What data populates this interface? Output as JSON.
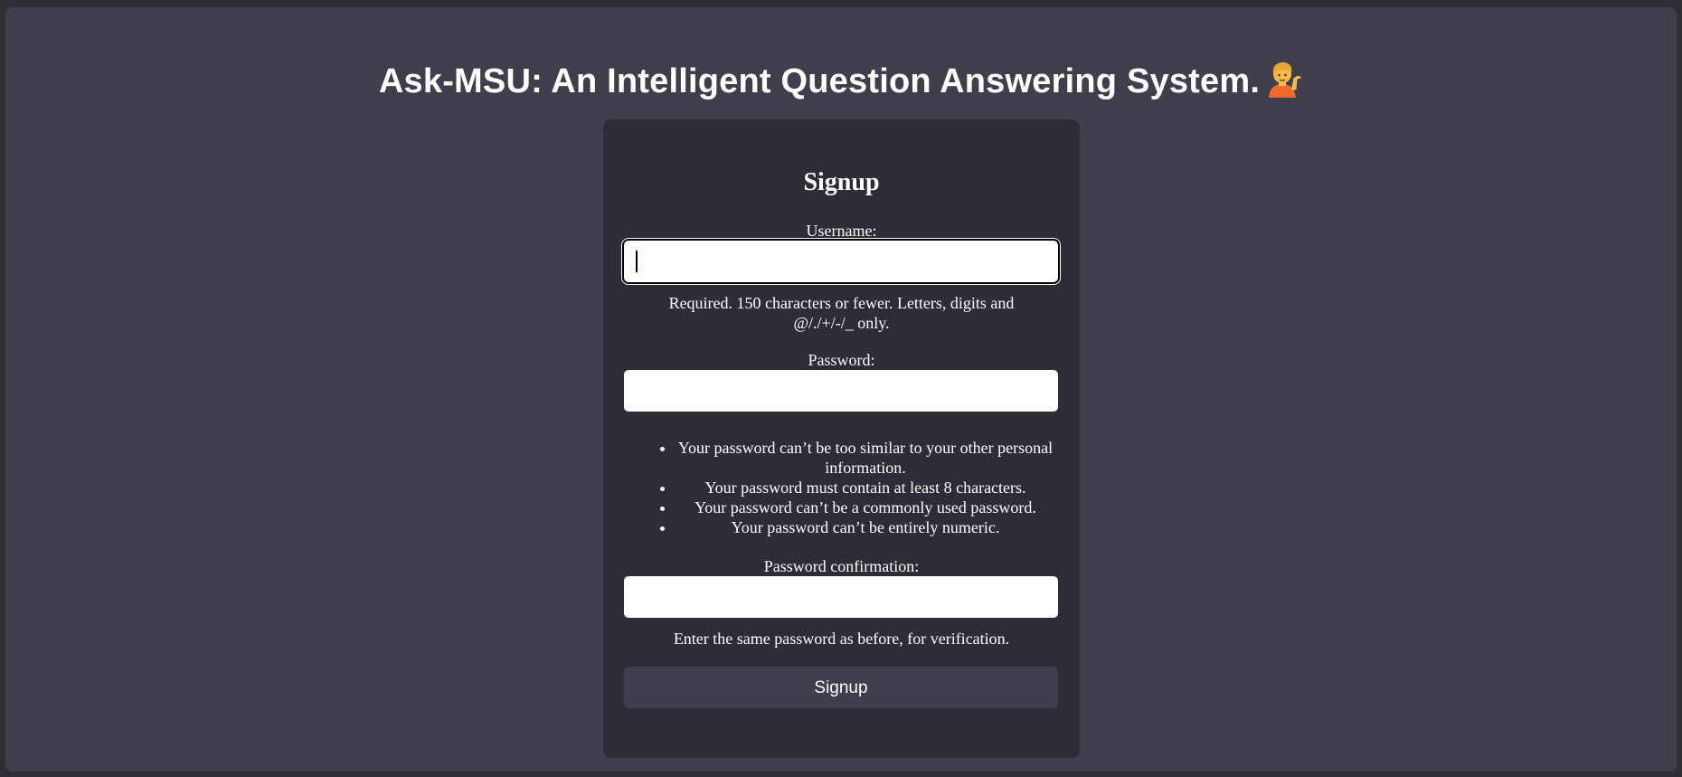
{
  "header": {
    "title": "Ask-MSU: An Intelligent Question Answering System.",
    "emoji_icon": "person-tipping-hand-icon"
  },
  "form": {
    "title": "Signup",
    "username": {
      "label": "Username:",
      "value": "",
      "help": "Required. 150 characters or fewer. Letters, digits and @/./+/-/_ only."
    },
    "password": {
      "label": "Password:",
      "value": "",
      "rules": [
        "Your password can’t be too similar to your other personal information.",
        "Your password must contain at least 8 characters.",
        "Your password can’t be a commonly used password.",
        "Your password can’t be entirely numeric."
      ]
    },
    "password_confirmation": {
      "label": "Password confirmation:",
      "value": "",
      "help": "Enter the same password as before, for verification."
    },
    "submit_label": "Signup"
  },
  "colors": {
    "page_bg": "#3e3f4b",
    "card_bg": "#2d2d38",
    "button_bg": "#3e3f4b",
    "text": "#ffffff",
    "emoji_skin": "#f7b84b",
    "emoji_shirt": "#ee6a2c"
  }
}
